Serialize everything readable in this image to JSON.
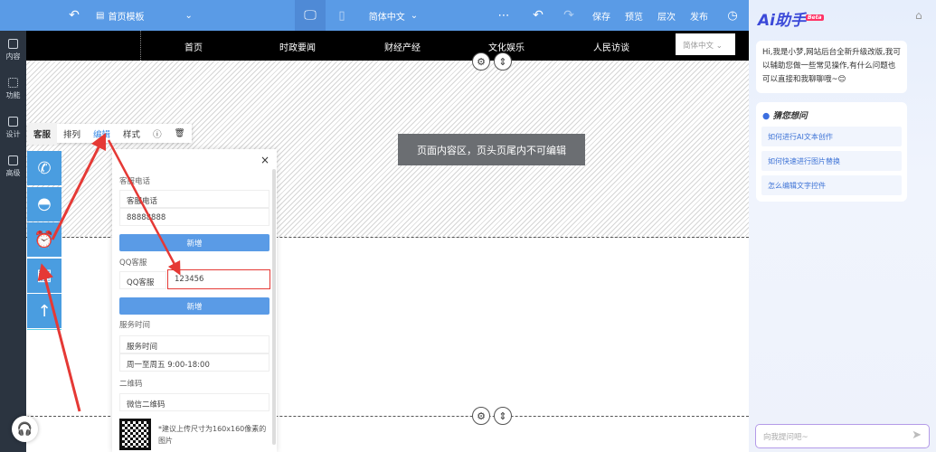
{
  "topbar": {
    "page_select": "首页模板",
    "language": "简体中文",
    "save": "保存",
    "preview": "预览",
    "layers": "层次",
    "publish": "发布"
  },
  "leftnav": [
    {
      "label": "内容"
    },
    {
      "label": "功能"
    },
    {
      "label": "设计"
    },
    {
      "label": "高级"
    }
  ],
  "site_nav": {
    "items": [
      "首页",
      "时政要闻",
      "财经产经",
      "文化娱乐",
      "人民访谈"
    ],
    "language": "简体中文"
  },
  "canvas": {
    "notice": "页面内容区，页头页尾内不可编辑"
  },
  "toolbar": {
    "items": [
      "客服",
      "排列",
      "编辑",
      "样式"
    ]
  },
  "panel": {
    "phone_label": "客服电话",
    "phone_name": "客服电话",
    "phone_value": "88888888",
    "add1": "新增",
    "qq_label": "QQ客服",
    "qq_name": "QQ客服",
    "qq_value": "123456",
    "add2": "新增",
    "time_label": "服务时间",
    "time_name": "服务时间",
    "time_value": "周一至周五 9:00-18:00",
    "qr_label": "二维码",
    "qr_name": "微信二维码",
    "qr_hint": "*建议上传尺寸为160x160像素的图片"
  },
  "ai": {
    "title": "Ai助手",
    "badge": "Beta",
    "greeting": "Hi,我是小梦,网站后台全新升级改版,我可以辅助您做一些常见操作,有什么问题也可以直接和我聊聊哦~😊",
    "guess_title": "猜您想问",
    "questions": [
      "如何进行AI文本创作",
      "如何快速进行图片替换",
      "怎么编辑文字控件"
    ],
    "input_placeholder": "向我提问吧~"
  }
}
